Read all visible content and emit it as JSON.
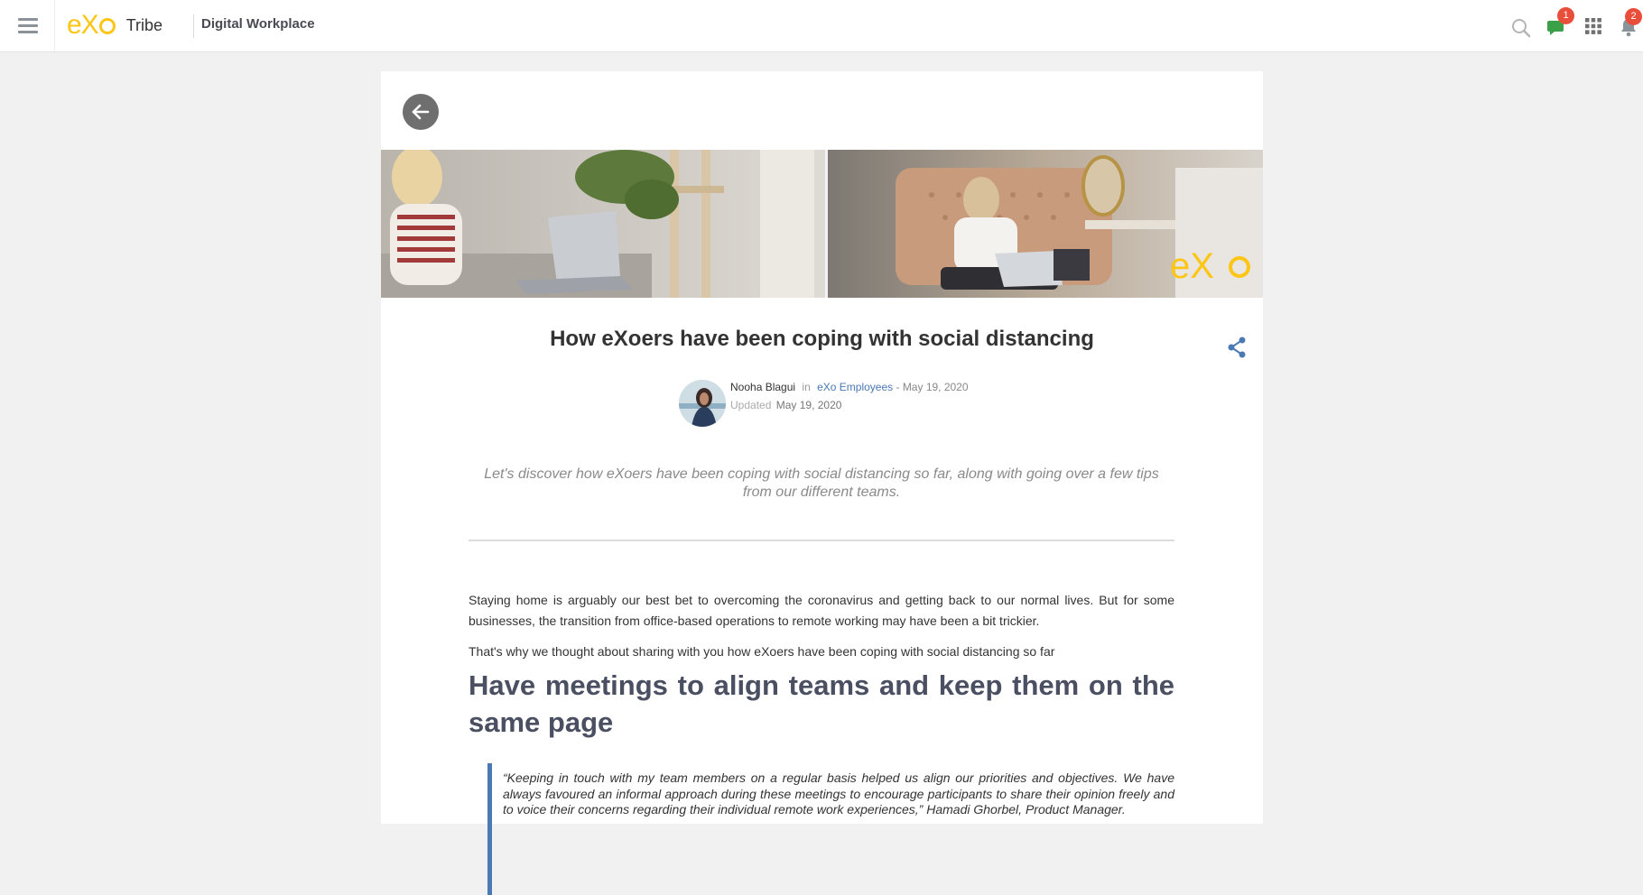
{
  "topbar": {
    "brand_logo_text": "eX",
    "brand_name": "Tribe",
    "space_title": "Digital Workplace",
    "chat_badge": "1",
    "notifications_badge": "2"
  },
  "article": {
    "title": "How eXoers have been coping with social distancing",
    "author": "Nooha Blagui",
    "in_label": "in",
    "space_link": "eXo Employees",
    "published": "- May 19, 2020",
    "updated_label": "Updated",
    "updated_date": "May 19, 2020",
    "summary": "Let's discover how eXoers have been coping with social distancing so far, along with going over a few tips from our different teams.",
    "paragraph1": "Staying home is arguably our best bet to overcoming the coronavirus and getting back to our normal lives. But for some businesses, the transition from office-based operations to remote working may have been a bit trickier.",
    "paragraph2": "That's why we thought about sharing with you how eXoers have been coping with social distancing so far",
    "heading1": "Have meetings to align teams and keep them on the same page",
    "quote1": "“Keeping in touch with my team members on a regular basis helped us align our priorities and objectives. We have always favoured an informal approach during these meetings to encourage participants to share their opinion freely and to voice their concerns regarding their individual remote work experiences,” Hamadi Ghorbel, Product Manager.",
    "banner_logo_text": "eX"
  },
  "colors": {
    "brand_yellow": "#fdc514",
    "link_blue": "#4a79b4",
    "badge_red": "#e94e3a",
    "chat_green": "#3aa14a",
    "heading": "#4a4f62"
  },
  "icons": [
    "hamburger-icon",
    "search-icon",
    "chat-icon",
    "apps-grid-icon",
    "bell-icon",
    "back-arrow-icon",
    "share-icon"
  ]
}
